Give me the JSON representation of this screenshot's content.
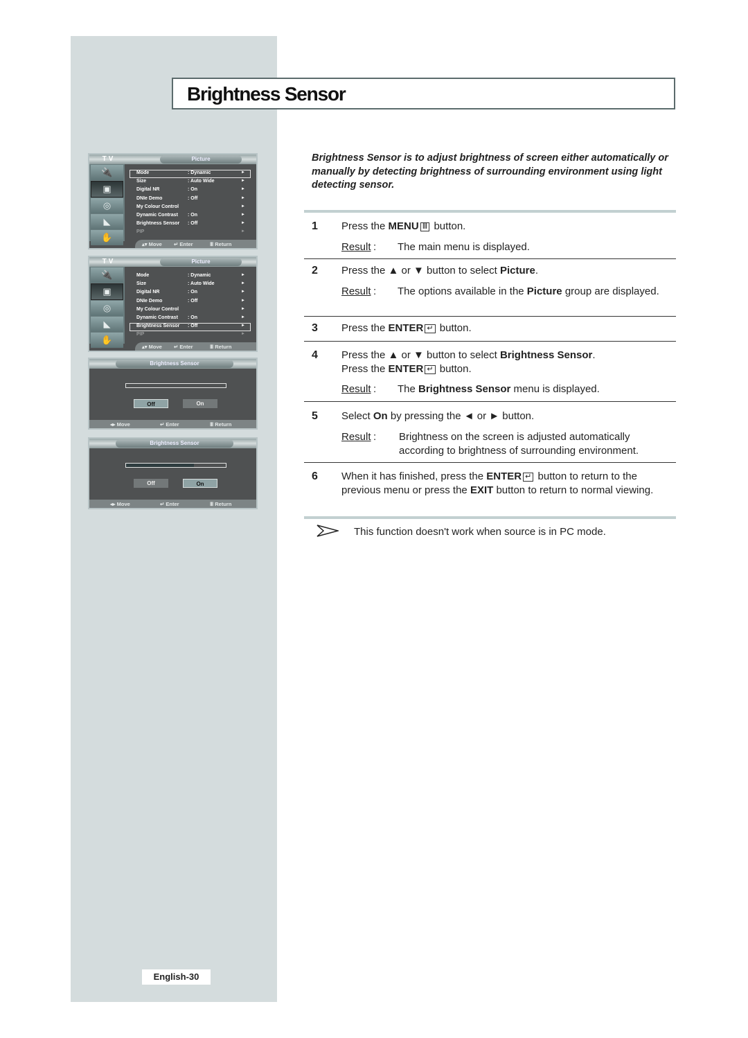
{
  "page": {
    "title": "Brightness Sensor",
    "page_number": "English-30",
    "intro": "Brightness Sensor is to adjust brightness of screen either automatically or manually by detecting brightness of surrounding environment using light detecting sensor."
  },
  "colors": {
    "sidebar_bg": "#d4dcdd",
    "osd_bg": "#4f5152",
    "rule_accent": "#c2d0d1"
  },
  "osd_menu": {
    "tv_label": "TV",
    "title": "Picture",
    "icons": [
      "input-icon",
      "picture-icon",
      "sound-icon",
      "channel-icon",
      "setup-icon"
    ],
    "items": [
      {
        "label": "Mode",
        "value": ": Dynamic"
      },
      {
        "label": "Size",
        "value": ": Auto Wide"
      },
      {
        "label": "Digital NR",
        "value": ": On"
      },
      {
        "label": "DNIe Demo",
        "value": ": Off"
      },
      {
        "label": "My Colour Control",
        "value": ""
      },
      {
        "label": "Dynamic Contrast",
        "value": ": On"
      },
      {
        "label": "Brightness Sensor",
        "value": ": Off"
      },
      {
        "label": "PIP",
        "value": ""
      }
    ],
    "footer": {
      "move": "Move",
      "enter": "Enter",
      "return": "Return"
    },
    "screens": [
      {
        "highlighted_item": "Mode"
      },
      {
        "highlighted_item": "Brightness Sensor"
      }
    ]
  },
  "osd_dialog": {
    "title": "Brightness Sensor",
    "off_label": "Off",
    "on_label": "On",
    "footer": {
      "move": "Move",
      "enter": "Enter",
      "return": "Return"
    },
    "screens": [
      {
        "selected": "Off",
        "level_percent": 0
      },
      {
        "selected": "On",
        "level_percent": 68
      }
    ]
  },
  "steps": [
    {
      "num": "1",
      "pre": "Press the ",
      "bold": "MENU",
      "post": " button.",
      "result": "The main menu is displayed."
    },
    {
      "num": "2",
      "pre": "Press the ▲ or ▼ button to select ",
      "bold": "Picture",
      "post": ".",
      "result_pre": "The options available in the ",
      "result_bold": "Picture",
      "result_post": " group are displayed."
    },
    {
      "num": "3",
      "pre": "Press the ",
      "bold": "ENTER",
      "post": " button."
    },
    {
      "num": "4",
      "pre": "Press the ▲ or ▼ button to select ",
      "bold": "Brightness Sensor",
      "post": ".",
      "line2_pre": "Press the ",
      "line2_bold": "ENTER",
      "line2_post": " button.",
      "result_pre": "The ",
      "result_bold": "Brightness Sensor",
      "result_post": " menu is displayed."
    },
    {
      "num": "5",
      "pre": "Select ",
      "bold": "On",
      "post": " by pressing the ◄ or ► button.",
      "result": "Brightness on the screen is adjusted automatically according to brightness of surrounding environment."
    },
    {
      "num": "6",
      "pre": "When it has finished, press the ",
      "bold": "ENTER",
      "post": " button to return to the previous menu or press the ",
      "bold2": "EXIT",
      "post2": " button to return to normal viewing."
    }
  ],
  "result_label": "Result",
  "note": "This function doesn't work when source is in PC mode."
}
